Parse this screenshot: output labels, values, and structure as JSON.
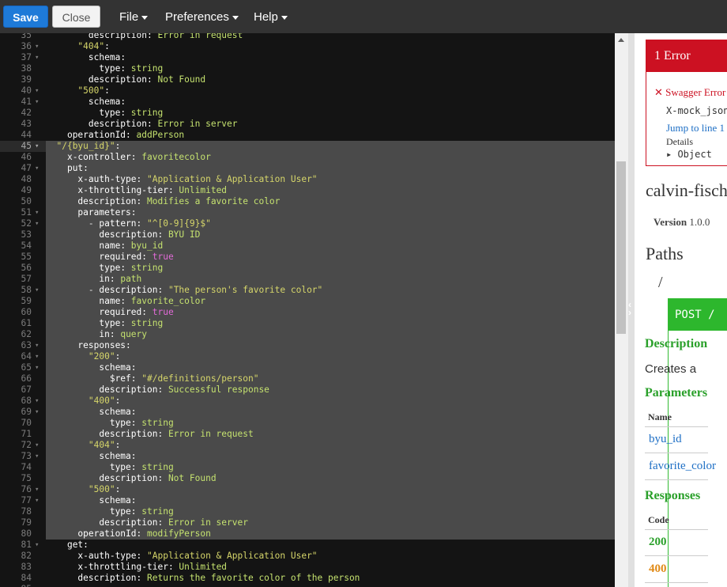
{
  "toolbar": {
    "save_label": "Save",
    "close_label": "Close",
    "menus": [
      "File",
      "Preferences",
      "Help"
    ]
  },
  "editor": {
    "lines": [
      {
        "n": "35",
        "f": "",
        "t": "        description: Error in request"
      },
      {
        "n": "36",
        "f": "▾",
        "t": "      \"404\":"
      },
      {
        "n": "37",
        "f": "▾",
        "t": "        schema:"
      },
      {
        "n": "38",
        "f": "",
        "t": "          type: string"
      },
      {
        "n": "39",
        "f": "",
        "t": "        description: Not Found"
      },
      {
        "n": "40",
        "f": "▾",
        "t": "      \"500\":"
      },
      {
        "n": "41",
        "f": "▾",
        "t": "        schema:"
      },
      {
        "n": "42",
        "f": "",
        "t": "          type: string"
      },
      {
        "n": "43",
        "f": "",
        "t": "        description: Error in server"
      },
      {
        "n": "44",
        "f": "",
        "t": "    operationId: addPerson"
      },
      {
        "n": "45",
        "f": "▾",
        "t": "  \"/{byu_id}\":"
      },
      {
        "n": "46",
        "f": "",
        "t": "    x-controller: favoritecolor"
      },
      {
        "n": "47",
        "f": "▾",
        "t": "    put:"
      },
      {
        "n": "48",
        "f": "",
        "t": "      x-auth-type: \"Application & Application User\""
      },
      {
        "n": "49",
        "f": "",
        "t": "      x-throttling-tier: Unlimited"
      },
      {
        "n": "50",
        "f": "",
        "t": "      description: Modifies a favorite color"
      },
      {
        "n": "51",
        "f": "▾",
        "t": "      parameters:"
      },
      {
        "n": "52",
        "f": "▾",
        "t": "        - pattern: \"^[0-9]{9}$\""
      },
      {
        "n": "53",
        "f": "",
        "t": "          description: BYU ID"
      },
      {
        "n": "54",
        "f": "",
        "t": "          name: byu_id"
      },
      {
        "n": "55",
        "f": "",
        "t": "          required: true"
      },
      {
        "n": "56",
        "f": "",
        "t": "          type: string"
      },
      {
        "n": "57",
        "f": "",
        "t": "          in: path"
      },
      {
        "n": "58",
        "f": "▾",
        "t": "        - description: \"The person's favorite color\""
      },
      {
        "n": "59",
        "f": "",
        "t": "          name: favorite_color"
      },
      {
        "n": "60",
        "f": "",
        "t": "          required: true"
      },
      {
        "n": "61",
        "f": "",
        "t": "          type: string"
      },
      {
        "n": "62",
        "f": "",
        "t": "          in: query"
      },
      {
        "n": "63",
        "f": "▾",
        "t": "      responses:"
      },
      {
        "n": "64",
        "f": "▾",
        "t": "        \"200\":"
      },
      {
        "n": "65",
        "f": "▾",
        "t": "          schema:"
      },
      {
        "n": "66",
        "f": "",
        "t": "            $ref: \"#/definitions/person\""
      },
      {
        "n": "67",
        "f": "",
        "t": "          description: Successful response"
      },
      {
        "n": "68",
        "f": "▾",
        "t": "        \"400\":"
      },
      {
        "n": "69",
        "f": "▾",
        "t": "          schema:"
      },
      {
        "n": "70",
        "f": "",
        "t": "            type: string"
      },
      {
        "n": "71",
        "f": "",
        "t": "          description: Error in request"
      },
      {
        "n": "72",
        "f": "▾",
        "t": "        \"404\":"
      },
      {
        "n": "73",
        "f": "▾",
        "t": "          schema:"
      },
      {
        "n": "74",
        "f": "",
        "t": "            type: string"
      },
      {
        "n": "75",
        "f": "",
        "t": "          description: Not Found"
      },
      {
        "n": "76",
        "f": "▾",
        "t": "        \"500\":"
      },
      {
        "n": "77",
        "f": "▾",
        "t": "          schema:"
      },
      {
        "n": "78",
        "f": "",
        "t": "            type: string"
      },
      {
        "n": "79",
        "f": "",
        "t": "          description: Error in server"
      },
      {
        "n": "80",
        "f": "",
        "t": "      operationId: modifyPerson"
      },
      {
        "n": "81",
        "f": "▾",
        "t": "    get:"
      },
      {
        "n": "82",
        "f": "",
        "t": "      x-auth-type: \"Application & Application User\""
      },
      {
        "n": "83",
        "f": "",
        "t": "      x-throttling-tier: Unlimited"
      },
      {
        "n": "84",
        "f": "",
        "t": "      description: Returns the favorite color of the person"
      },
      {
        "n": "85",
        "f": "",
        "t": ""
      }
    ],
    "selection": {
      "from": "45",
      "to": "80"
    },
    "active_line": "45",
    "colors": {
      "key": "#ffffff",
      "string": "#d6d66a",
      "value": "#c5e26f",
      "bool": "#e26bd8",
      "dash": "#e6e6e6",
      "selection": "#4a4a4a",
      "background": "#141414"
    }
  },
  "preview": {
    "error_header": "1 Error",
    "error_title": "Swagger Error",
    "error_code": "X-mock_json",
    "error_jump": "Jump to line 1",
    "error_details": "Details",
    "error_object": "▸ Object",
    "api_title": "calvin-fischer",
    "version_label": "Version",
    "version_value": "1.0.0",
    "paths_heading": "Paths",
    "path": "/",
    "operation": "POST /",
    "description_heading": "Description",
    "description_text": "Creates a",
    "parameters_heading": "Parameters",
    "name_header": "Name",
    "params": [
      "byu_id",
      "favorite_color"
    ],
    "responses_heading": "Responses",
    "code_header": "Code",
    "codes": [
      "200",
      "400"
    ]
  }
}
